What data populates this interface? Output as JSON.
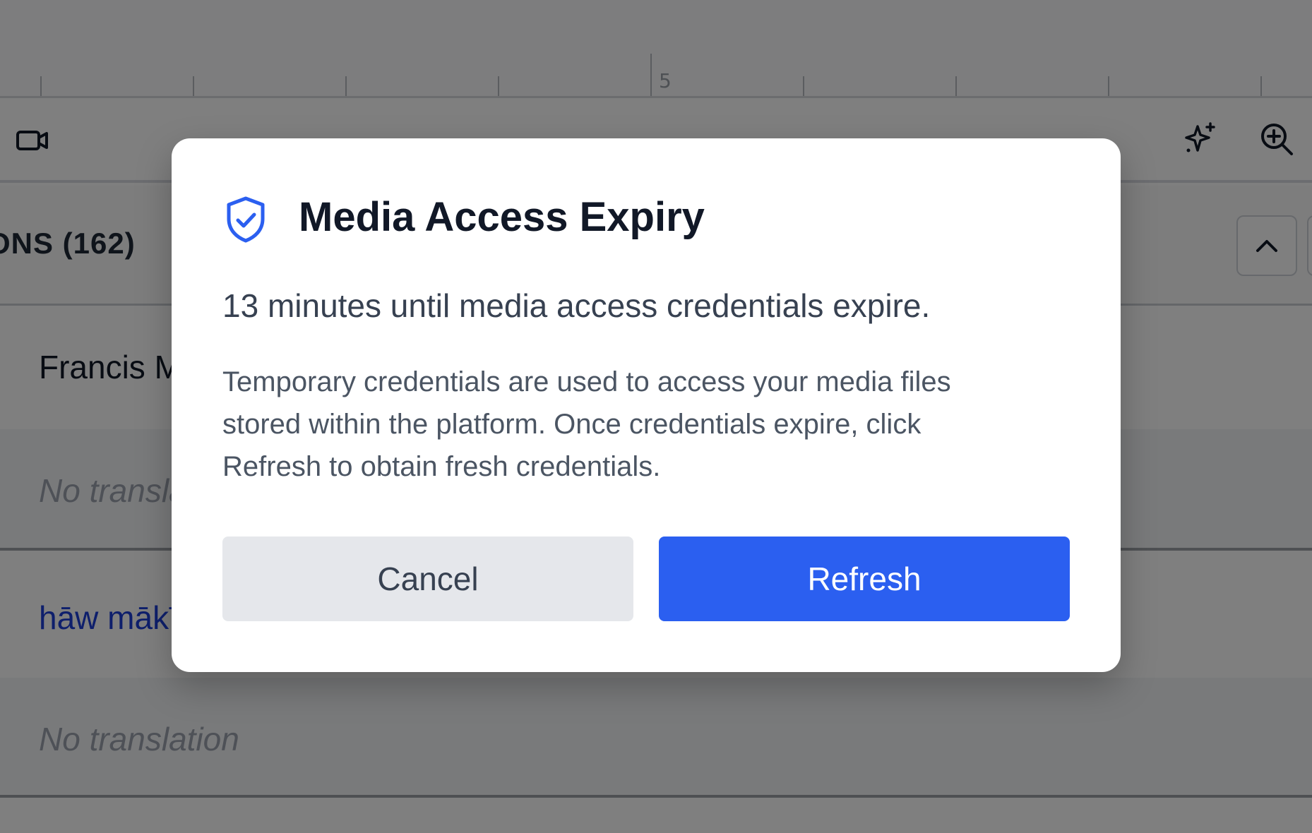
{
  "ruler": {
    "marker_label": "5"
  },
  "section": {
    "title": "ONS (162)"
  },
  "rows": [
    {
      "text": "Francis M"
    },
    {
      "text": "No translation"
    },
    {
      "text": "hāw mākīmā"
    },
    {
      "text": "No translation"
    }
  ],
  "icons": {
    "video": "video-camera-icon",
    "ai": "sparkle-icon",
    "zoom": "zoom-in-icon",
    "collapse": "chevron-up-icon",
    "shield": "shield-check-icon"
  },
  "modal": {
    "title": "Media Access Expiry",
    "lead": "13 minutes until media access credentials expire.",
    "body_lines": [
      "Temporary credentials are used to access your media files",
      "stored within the platform. Once credentials expire, click",
      "Refresh to obtain fresh credentials."
    ],
    "cancel_label": "Cancel",
    "refresh_label": "Refresh"
  },
  "colors": {
    "accent": "#2b5ff0",
    "link_text": "#1d3fd8",
    "overlay": "rgba(0,0,0,0.5)"
  }
}
